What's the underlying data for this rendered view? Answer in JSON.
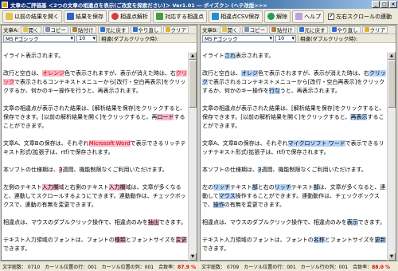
{
  "window": {
    "title": "文章のご評価基 ＜2つの文章の相違点を表示(ご改変を探索ださい)＞ Ver1.01 ― ポイズクン (ヘテ改版>>>"
  },
  "toolbar": {
    "compare_label": "以前の結果を開く",
    "save_label": "結果を保存",
    "analyze_label": "相違点解析",
    "corresponding_label": "対応する相違点",
    "csv_label": "相違点CSV保存",
    "cancel_label": "解除",
    "help_label": "ヘルプ",
    "sync_scroll_label": "左右スクロールの連動"
  },
  "left": {
    "label": "文章A:",
    "open": "開く",
    "copy": "コピー",
    "paste": "貼付け",
    "undo": "元に戻す",
    "redo": "やり直し",
    "clear": "クリア",
    "font": "MS Pゴシック",
    "size": "10",
    "dblclick": "相違(ダブルクリック時):"
  },
  "right": {
    "label": "文章B:",
    "open": "開く",
    "copy": "コピー",
    "paste": "貼付け",
    "undo": "元に戻す",
    "redo": "やり直し",
    "clear": "クリア",
    "font": "MS Pゴシック",
    "size": "10",
    "dblclick": "相違(ダブルクリック時):"
  },
  "left_text": {
    "p1": "イライト表示されます。",
    "p2a": "改行と空白は、",
    "p2h1": "オレンジ",
    "p2b": "色で表示されますが、表示が消えた時は、右",
    "p2h2": "クリック",
    "p2c": "で表示されるコンテキストメニューから[改行・空白再表示]をクリックするか、何かのキー操作を行うと、再表示されます。",
    "p3a": "文章の相違点が表示された結果は、[解析結果を保存]をクリックすると、保存できます。[以前の解析結果を開く]をクリックすると、再",
    "p3h": "ロード",
    "p3b": "することができます。",
    "p4a": "文章A、文章Bの保存は、それぞれ",
    "p4h": "Microsoft Word",
    "p4b": "で表示できるリッチテキスト形式(拡張子は、rtf)で保存されます。",
    "p5a": "本ソフトの仕様期は、",
    "p5h": "3",
    "p5b": "週間、機能制限なくご利用いただけます。",
    "p6a": "左側のテキスト",
    "p6h1": "入力欄",
    "p6b": "域と右側のテキスト",
    "p6h2": "入力欄",
    "p6c": "域は、文章が多くなると、連動してスクロールするようにできます。連動動作は、チェックボックスで、連動の有無を変更できます。",
    "p7a": "相違点は、マウスのダブルクリック操作で、相違点のみを",
    "p7h": "抽出",
    "p7b": "できます。",
    "p8a": "テキスト入力領域のフォントは、フォントの",
    "p8h1": "種類",
    "p8b": "とフォントサイズを",
    "p8h2": "変更",
    "p8c": "できます。"
  },
  "right_text": {
    "p1a": "イライト",
    "p1h": "され",
    "p1b": "表示されます。",
    "p2a": "改行と空白は、",
    "p2h1": "オレジ",
    "p2b": "色で表示されますが、表示が消えた時は、右",
    "p2h2": "クリック",
    "p2c": "で表示されるコンテキストメニューから[改行・空白再表示]をクリックするか、何かのキー操作を",
    "p2h3": "行な",
    "p2d": "うと、再表示されます。",
    "p3a": "文章の相違点が表示された結果は、[解析結果を保存]をクリックすると、保存できます。[以前の解析結果を開く]をクリックすると、",
    "p3h": "再表示",
    "p3b": "することができます。",
    "p4a": "文章A、文章Bの保存は、それぞれ",
    "p4h": "マイクロソフト ワード",
    "p4b": "で表示できるリッチテキスト形式(拡張子は、rtf)で保存されます。",
    "p5a": "本ソフトの仕様期は、",
    "p5h": "3",
    "p5b": "週間、機能制限なくご利用いただけます。",
    "p6a": "左の",
    "p6h1": "リッチ",
    "p6b": "テキスト",
    "p6h2": "部",
    "p6c": "と右の",
    "p6h3": "リッチ",
    "p6d": "テキスト",
    "p6h4": "部",
    "p6e": "は、文章が多くなると、連動して",
    "p6h5": "マウス",
    "p6f": "操作することができます。連動動作は、チェックボックスで、",
    "p6h6": "操作",
    "p6g": "の有無を変更できます。",
    "p7a": "相違点は、マウスのダブルクリック操作で、相違点のみを",
    "p7h": "表示",
    "p7b": "できます。",
    "p8a": "テキスト入力領域のフォントは、フォントの",
    "p8h1": "名称",
    "p8b": "とフォントサイズを",
    "p8h2": "更新",
    "p8c": "できます。"
  },
  "status": {
    "left": {
      "chars": "文字総数： 0710",
      "line": "カーソル位置の行：001",
      "col": "カーソル位置の列：001",
      "rate_label": "合致率：",
      "rate": "87.9 %"
    },
    "right": {
      "chars": "文字総数： 0709",
      "line": "カーソル位置の行：001",
      "col": "カーソル行の列：001",
      "rate_label": "合致率：",
      "rate": "88.0 %"
    }
  },
  "colors": {
    "pink": "#f6b8c8",
    "blue": "#b6d4f6",
    "red": "#e00000",
    "titlebar": "#0a246a"
  }
}
